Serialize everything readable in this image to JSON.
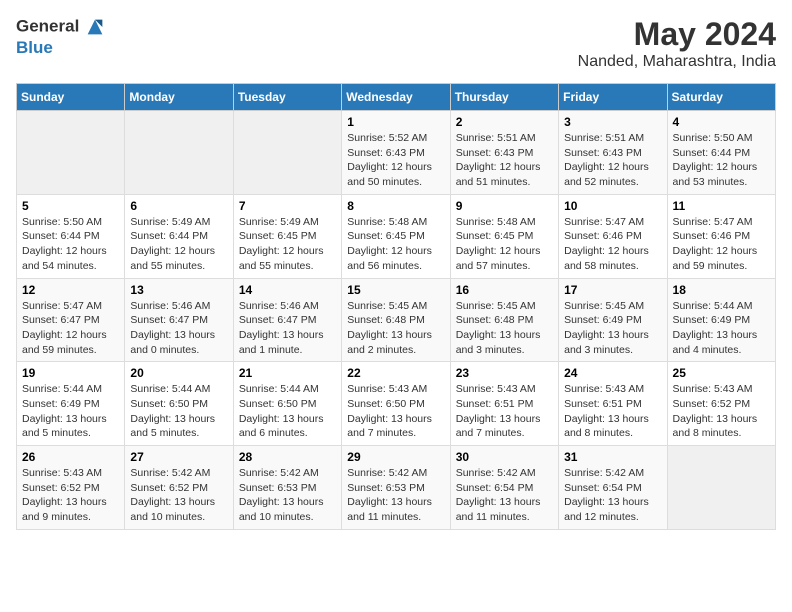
{
  "header": {
    "logo_line1": "General",
    "logo_line2": "Blue",
    "month": "May 2024",
    "location": "Nanded, Maharashtra, India"
  },
  "columns": [
    "Sunday",
    "Monday",
    "Tuesday",
    "Wednesday",
    "Thursday",
    "Friday",
    "Saturday"
  ],
  "weeks": [
    [
      {
        "day": "",
        "content": ""
      },
      {
        "day": "",
        "content": ""
      },
      {
        "day": "",
        "content": ""
      },
      {
        "day": "1",
        "content": "Sunrise: 5:52 AM\nSunset: 6:43 PM\nDaylight: 12 hours\nand 50 minutes."
      },
      {
        "day": "2",
        "content": "Sunrise: 5:51 AM\nSunset: 6:43 PM\nDaylight: 12 hours\nand 51 minutes."
      },
      {
        "day": "3",
        "content": "Sunrise: 5:51 AM\nSunset: 6:43 PM\nDaylight: 12 hours\nand 52 minutes."
      },
      {
        "day": "4",
        "content": "Sunrise: 5:50 AM\nSunset: 6:44 PM\nDaylight: 12 hours\nand 53 minutes."
      }
    ],
    [
      {
        "day": "5",
        "content": "Sunrise: 5:50 AM\nSunset: 6:44 PM\nDaylight: 12 hours\nand 54 minutes."
      },
      {
        "day": "6",
        "content": "Sunrise: 5:49 AM\nSunset: 6:44 PM\nDaylight: 12 hours\nand 55 minutes."
      },
      {
        "day": "7",
        "content": "Sunrise: 5:49 AM\nSunset: 6:45 PM\nDaylight: 12 hours\nand 55 minutes."
      },
      {
        "day": "8",
        "content": "Sunrise: 5:48 AM\nSunset: 6:45 PM\nDaylight: 12 hours\nand 56 minutes."
      },
      {
        "day": "9",
        "content": "Sunrise: 5:48 AM\nSunset: 6:45 PM\nDaylight: 12 hours\nand 57 minutes."
      },
      {
        "day": "10",
        "content": "Sunrise: 5:47 AM\nSunset: 6:46 PM\nDaylight: 12 hours\nand 58 minutes."
      },
      {
        "day": "11",
        "content": "Sunrise: 5:47 AM\nSunset: 6:46 PM\nDaylight: 12 hours\nand 59 minutes."
      }
    ],
    [
      {
        "day": "12",
        "content": "Sunrise: 5:47 AM\nSunset: 6:47 PM\nDaylight: 12 hours\nand 59 minutes."
      },
      {
        "day": "13",
        "content": "Sunrise: 5:46 AM\nSunset: 6:47 PM\nDaylight: 13 hours\nand 0 minutes."
      },
      {
        "day": "14",
        "content": "Sunrise: 5:46 AM\nSunset: 6:47 PM\nDaylight: 13 hours\nand 1 minute."
      },
      {
        "day": "15",
        "content": "Sunrise: 5:45 AM\nSunset: 6:48 PM\nDaylight: 13 hours\nand 2 minutes."
      },
      {
        "day": "16",
        "content": "Sunrise: 5:45 AM\nSunset: 6:48 PM\nDaylight: 13 hours\nand 3 minutes."
      },
      {
        "day": "17",
        "content": "Sunrise: 5:45 AM\nSunset: 6:49 PM\nDaylight: 13 hours\nand 3 minutes."
      },
      {
        "day": "18",
        "content": "Sunrise: 5:44 AM\nSunset: 6:49 PM\nDaylight: 13 hours\nand 4 minutes."
      }
    ],
    [
      {
        "day": "19",
        "content": "Sunrise: 5:44 AM\nSunset: 6:49 PM\nDaylight: 13 hours\nand 5 minutes."
      },
      {
        "day": "20",
        "content": "Sunrise: 5:44 AM\nSunset: 6:50 PM\nDaylight: 13 hours\nand 5 minutes."
      },
      {
        "day": "21",
        "content": "Sunrise: 5:44 AM\nSunset: 6:50 PM\nDaylight: 13 hours\nand 6 minutes."
      },
      {
        "day": "22",
        "content": "Sunrise: 5:43 AM\nSunset: 6:50 PM\nDaylight: 13 hours\nand 7 minutes."
      },
      {
        "day": "23",
        "content": "Sunrise: 5:43 AM\nSunset: 6:51 PM\nDaylight: 13 hours\nand 7 minutes."
      },
      {
        "day": "24",
        "content": "Sunrise: 5:43 AM\nSunset: 6:51 PM\nDaylight: 13 hours\nand 8 minutes."
      },
      {
        "day": "25",
        "content": "Sunrise: 5:43 AM\nSunset: 6:52 PM\nDaylight: 13 hours\nand 8 minutes."
      }
    ],
    [
      {
        "day": "26",
        "content": "Sunrise: 5:43 AM\nSunset: 6:52 PM\nDaylight: 13 hours\nand 9 minutes."
      },
      {
        "day": "27",
        "content": "Sunrise: 5:42 AM\nSunset: 6:52 PM\nDaylight: 13 hours\nand 10 minutes."
      },
      {
        "day": "28",
        "content": "Sunrise: 5:42 AM\nSunset: 6:53 PM\nDaylight: 13 hours\nand 10 minutes."
      },
      {
        "day": "29",
        "content": "Sunrise: 5:42 AM\nSunset: 6:53 PM\nDaylight: 13 hours\nand 11 minutes."
      },
      {
        "day": "30",
        "content": "Sunrise: 5:42 AM\nSunset: 6:54 PM\nDaylight: 13 hours\nand 11 minutes."
      },
      {
        "day": "31",
        "content": "Sunrise: 5:42 AM\nSunset: 6:54 PM\nDaylight: 13 hours\nand 12 minutes."
      },
      {
        "day": "",
        "content": ""
      }
    ]
  ]
}
